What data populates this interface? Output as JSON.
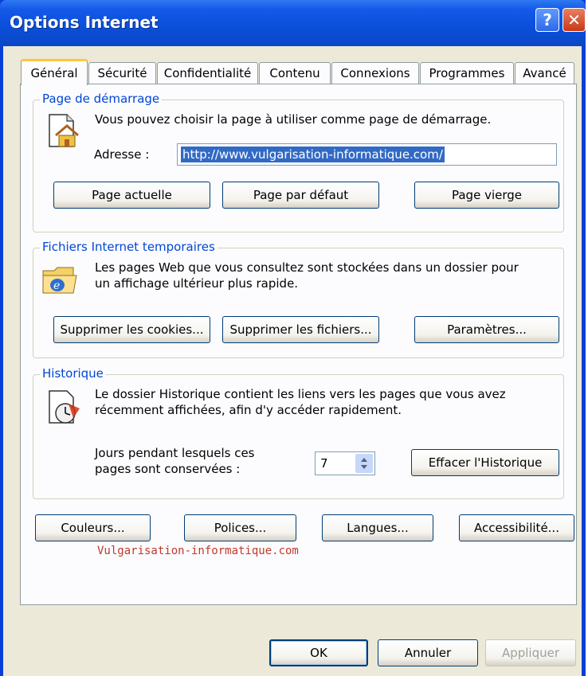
{
  "window": {
    "title": "Options Internet",
    "help_glyph": "?",
    "close_glyph": "✕"
  },
  "tabs": [
    {
      "label": "Général",
      "active": true
    },
    {
      "label": "Sécurité",
      "active": false
    },
    {
      "label": "Confidentialité",
      "active": false
    },
    {
      "label": "Contenu",
      "active": false
    },
    {
      "label": "Connexions",
      "active": false
    },
    {
      "label": "Programmes",
      "active": false
    },
    {
      "label": "Avancé",
      "active": false
    }
  ],
  "homepage": {
    "legend": "Page de démarrage",
    "description": "Vous pouvez choisir la page à utiliser comme page de démarrage.",
    "address_label": "Adresse :",
    "address_value": "http://www.vulgarisation-informatique.com/",
    "buttons": {
      "current": "Page actuelle",
      "default": "Page par défaut",
      "blank": "Page vierge"
    },
    "icon": "house-page-icon"
  },
  "temp_files": {
    "legend": "Fichiers Internet temporaires",
    "description_line1": "Les pages Web que vous consultez sont stockées dans un dossier pour",
    "description_line2": "un affichage ultérieur plus rapide.",
    "buttons": {
      "cookies": "Supprimer les cookies...",
      "files": "Supprimer les fichiers...",
      "settings": "Paramètres..."
    },
    "icon": "ie-folder-icon"
  },
  "history": {
    "legend": "Historique",
    "description_line1": "Le dossier Historique contient les liens vers les pages que vous avez",
    "description_line2": "récemment affichées, afin d'y accéder rapidement.",
    "days_label_line1": "Jours pendant lesquels ces",
    "days_label_line2": "pages sont conservées :",
    "days_value": "7",
    "clear_button": "Effacer l'Historique",
    "icon": "history-clock-icon"
  },
  "bottom_buttons": {
    "colors": "Couleurs...",
    "fonts": "Polices...",
    "languages": "Langues...",
    "accessibility": "Accessibilité..."
  },
  "watermark": "Vulgarisation-informatique.com",
  "dialog_buttons": {
    "ok": "OK",
    "cancel": "Annuler",
    "apply": "Appliquer"
  },
  "colors": {
    "title_bar": "#0a4fd9",
    "legend_text": "#0046d5",
    "face": "#ece9d8",
    "selection": "#316ac5"
  }
}
